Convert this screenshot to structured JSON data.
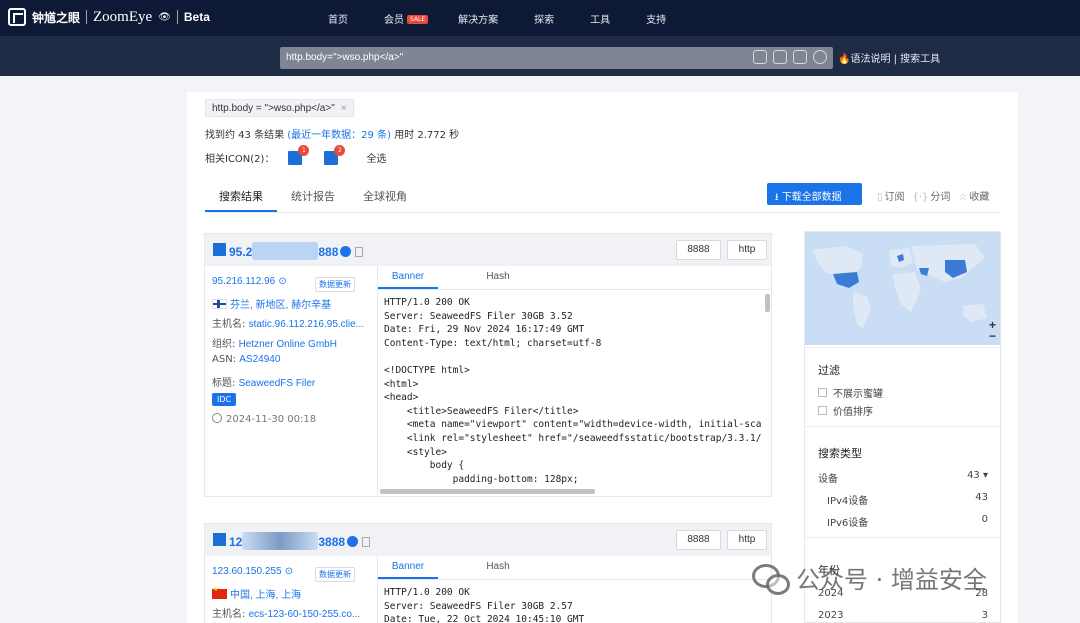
{
  "brand": {
    "cn": "钟馗之眼",
    "en": "ZoomEye",
    "beta": "Beta"
  },
  "nav": [
    {
      "label": "首页"
    },
    {
      "label": "会员",
      "badge": "SALE"
    },
    {
      "label": "解决方案"
    },
    {
      "label": "探索"
    },
    {
      "label": "工具"
    },
    {
      "label": "支持"
    }
  ],
  "search": {
    "query": "http.body=\">wso.php</a>\"",
    "syntax_link": "语法说明 | 搜索工具"
  },
  "filter_chip": {
    "label": "http.body = \">wso.php</a>\"",
    "close": "×"
  },
  "results_summary": {
    "prefix": "找到约 43 条结果",
    "recent": "(最近一年数据：29 条)",
    "time": "用时 2.772 秒"
  },
  "related_icons": {
    "label": "相关ICON(2)：",
    "counts": [
      "1",
      "2"
    ],
    "select_all": "全选"
  },
  "tabs": [
    "搜索结果",
    "统计报告",
    "全球视角"
  ],
  "download_button": "下载全部数据",
  "actions": [
    "订阅",
    "分词",
    "收藏"
  ],
  "results": [
    {
      "host_prefix": "95.2",
      "host_suffix": "888",
      "ports": [
        "8888",
        "http"
      ],
      "ip": "95.216.112.96",
      "data_update": "数据更新",
      "location": "芬兰, 新地区, 赫尔辛基",
      "hostname_label": "主机名:",
      "hostname": "static.96.112.216.95.clie...",
      "org_label": "组织:",
      "org": "Hetzner Online GmbH",
      "asn_label": "ASN:",
      "asn": "AS24940",
      "title_label": "标题:",
      "title": "SeaweedFS Filer",
      "tag": "IDC",
      "time": "2024-11-30 00:18",
      "banner_tabs": [
        "Banner",
        "Hash"
      ],
      "banner": "HTTP/1.0 200 OK\nServer: SeaweedFS Filer 30GB 3.52\nDate: Fri, 29 Nov 2024 16:17:49 GMT\nContent-Type: text/html; charset=utf-8\n\n<!DOCTYPE html>\n<html>\n<head>\n    <title>SeaweedFS Filer</title>\n    <meta name=\"viewport\" content=\"width=device-width, initial-sca\n    <link rel=\"stylesheet\" href=\"/seaweedfsstatic/bootstrap/3.3.1/\n    <style>\n        body {\n            padding-bottom: 128px;"
    },
    {
      "host_prefix": "12",
      "host_suffix": "3888",
      "ports": [
        "8888",
        "http"
      ],
      "ip": "123.60.150.255",
      "data_update": "数据更新",
      "location": "中国, 上海, 上海",
      "hostname_label": "主机名:",
      "hostname": "ecs-123-60-150-255.co...",
      "banner_tabs": [
        "Banner",
        "Hash"
      ],
      "banner": "HTTP/1.0 200 OK\nServer: SeaweedFS Filer 30GB 2.57\nDate: Tue, 22 Oct 2024 10:45:10 GMT"
    }
  ],
  "sidebar": {
    "zoom_in": "+",
    "zoom_out": "−",
    "filter_title": "过滤",
    "filters": [
      "不展示蜜罐",
      "价值排序"
    ],
    "search_type_title": "搜索类型",
    "device_label": "设备",
    "device_count": "43 ▾",
    "ipv4_label": "IPv4设备",
    "ipv4_count": "43",
    "ipv6_label": "IPv6设备",
    "ipv6_count": "0",
    "year_title": "年份",
    "years": [
      {
        "year": "2024",
        "count": "28"
      },
      {
        "year": "2023",
        "count": "3"
      }
    ]
  },
  "watermark": "公众号 · 增益安全"
}
